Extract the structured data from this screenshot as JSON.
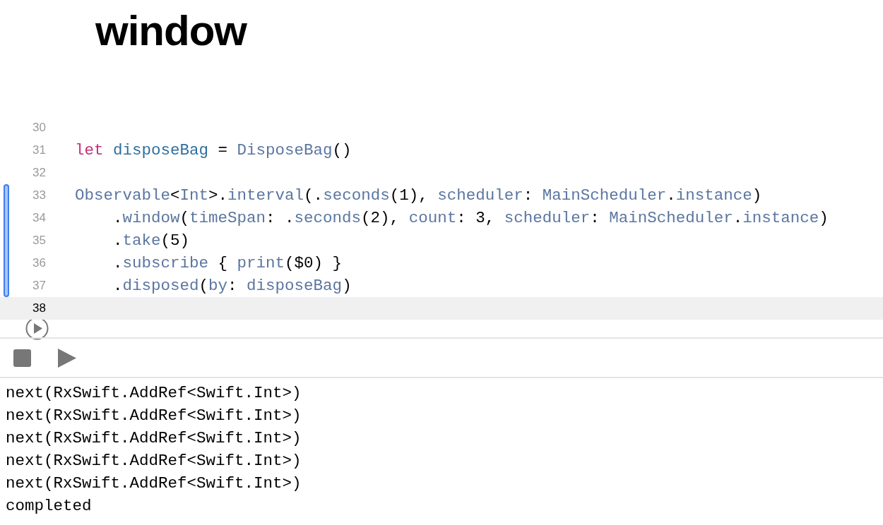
{
  "title": "window",
  "editor": {
    "lines": [
      {
        "number": "30",
        "modified": false,
        "current": false
      },
      {
        "number": "31",
        "modified": false,
        "current": false,
        "tokens": [
          {
            "kind": "keyword",
            "text": "let "
          },
          {
            "kind": "declaration",
            "text": "disposeBag"
          },
          {
            "kind": "plain",
            "text": " = "
          },
          {
            "kind": "identifier",
            "text": "DisposeBag"
          },
          {
            "kind": "plain",
            "text": "()"
          }
        ]
      },
      {
        "number": "32",
        "modified": false,
        "current": false
      },
      {
        "number": "33",
        "modified": true,
        "current": false,
        "tokens": [
          {
            "kind": "identifier",
            "text": "Observable"
          },
          {
            "kind": "plain",
            "text": "<"
          },
          {
            "kind": "identifier",
            "text": "Int"
          },
          {
            "kind": "plain",
            "text": ">."
          },
          {
            "kind": "identifier",
            "text": "interval"
          },
          {
            "kind": "plain",
            "text": "(."
          },
          {
            "kind": "identifier",
            "text": "seconds"
          },
          {
            "kind": "plain",
            "text": "(1), "
          },
          {
            "kind": "identifier",
            "text": "scheduler"
          },
          {
            "kind": "plain",
            "text": ": "
          },
          {
            "kind": "identifier",
            "text": "MainScheduler"
          },
          {
            "kind": "plain",
            "text": "."
          },
          {
            "kind": "identifier",
            "text": "instance"
          },
          {
            "kind": "plain",
            "text": ")"
          }
        ]
      },
      {
        "number": "34",
        "modified": true,
        "current": false,
        "tokens": [
          {
            "kind": "plain",
            "text": "    ."
          },
          {
            "kind": "identifier",
            "text": "window"
          },
          {
            "kind": "plain",
            "text": "("
          },
          {
            "kind": "identifier",
            "text": "timeSpan"
          },
          {
            "kind": "plain",
            "text": ": ."
          },
          {
            "kind": "identifier",
            "text": "seconds"
          },
          {
            "kind": "plain",
            "text": "(2), "
          },
          {
            "kind": "identifier",
            "text": "count"
          },
          {
            "kind": "plain",
            "text": ": 3, "
          },
          {
            "kind": "identifier",
            "text": "scheduler"
          },
          {
            "kind": "plain",
            "text": ": "
          },
          {
            "kind": "identifier",
            "text": "MainScheduler"
          },
          {
            "kind": "plain",
            "text": "."
          },
          {
            "kind": "identifier",
            "text": "instance"
          },
          {
            "kind": "plain",
            "text": ")"
          }
        ]
      },
      {
        "number": "35",
        "modified": true,
        "current": false,
        "tokens": [
          {
            "kind": "plain",
            "text": "    ."
          },
          {
            "kind": "identifier",
            "text": "take"
          },
          {
            "kind": "plain",
            "text": "(5)"
          }
        ]
      },
      {
        "number": "36",
        "modified": true,
        "current": false,
        "tokens": [
          {
            "kind": "plain",
            "text": "    ."
          },
          {
            "kind": "identifier",
            "text": "subscribe"
          },
          {
            "kind": "plain",
            "text": " { "
          },
          {
            "kind": "identifier",
            "text": "print"
          },
          {
            "kind": "plain",
            "text": "($0) }"
          }
        ]
      },
      {
        "number": "37",
        "modified": true,
        "current": false,
        "tokens": [
          {
            "kind": "plain",
            "text": "    ."
          },
          {
            "kind": "identifier",
            "text": "disposed"
          },
          {
            "kind": "plain",
            "text": "("
          },
          {
            "kind": "identifier",
            "text": "by"
          },
          {
            "kind": "plain",
            "text": ": "
          },
          {
            "kind": "identifier",
            "text": "disposeBag"
          },
          {
            "kind": "plain",
            "text": ")"
          }
        ]
      },
      {
        "number": "38",
        "modified": false,
        "current": true
      }
    ]
  },
  "console": {
    "lines": [
      "next(RxSwift.AddRef<Swift.Int>)",
      "next(RxSwift.AddRef<Swift.Int>)",
      "next(RxSwift.AddRef<Swift.Int>)",
      "next(RxSwift.AddRef<Swift.Int>)",
      "next(RxSwift.AddRef<Swift.Int>)",
      "completed"
    ]
  }
}
